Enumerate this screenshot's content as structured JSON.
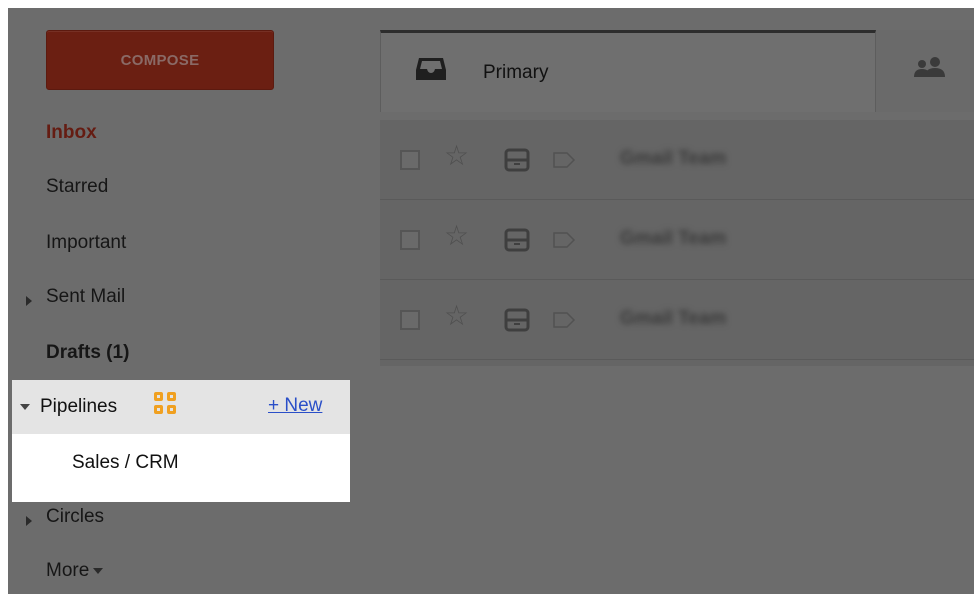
{
  "compose": {
    "label": "COMPOSE"
  },
  "sidebar": {
    "items": [
      {
        "label": "Inbox"
      },
      {
        "label": "Starred"
      },
      {
        "label": "Important"
      },
      {
        "label": "Sent Mail"
      },
      {
        "label": "Drafts (1)"
      }
    ],
    "pipelines": {
      "label": "Pipelines",
      "new_link": "+ New",
      "children": [
        {
          "label": "Sales / CRM"
        }
      ]
    },
    "circles": {
      "label": "Circles"
    },
    "more": {
      "label": "More"
    }
  },
  "tabs": [
    {
      "label": "Primary",
      "icon": "inbox-tray-icon"
    },
    {
      "label": "",
      "icon": "people-icon"
    }
  ],
  "mail_rows": [
    {
      "sender": "Gmail Team"
    },
    {
      "sender": "Gmail Team"
    },
    {
      "sender": "Gmail Team"
    }
  ],
  "colors": {
    "compose_button": "#6b1f12",
    "inbox_label": "#651c12",
    "new_link": "#2a4fc8",
    "pipelines_icon": "#f0a020",
    "overlay": "#6c6c6c"
  }
}
